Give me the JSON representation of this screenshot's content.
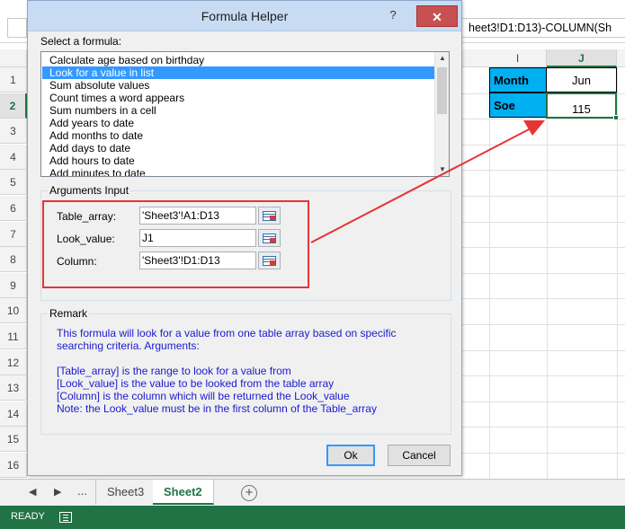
{
  "excel": {
    "formula_bar": {
      "text": "heet3!D1:D13)-COLUMN(Sh"
    },
    "columns": [
      {
        "label": "I",
        "active": false
      },
      {
        "label": "J",
        "active": true
      }
    ],
    "rows": [
      "1",
      "2",
      "3",
      "4",
      "5",
      "6",
      "7",
      "8",
      "9",
      "10",
      "11",
      "12",
      "13",
      "14",
      "15",
      "16"
    ],
    "active_row": "2",
    "cells": {
      "i1": "Month",
      "j1": "Jun",
      "i2": "Soe",
      "j2": "115"
    },
    "sheet_tabs": {
      "nav_prev": "◀",
      "nav_next": "▶",
      "ellipsis": "...",
      "tabs": [
        "Sheet3",
        "Sheet2"
      ],
      "active": "Sheet2",
      "add": "+"
    },
    "status": {
      "ready": "READY"
    },
    "colors": {
      "brand": "#217346",
      "highlight": "#00b0f0",
      "annotation": "#e53535"
    }
  },
  "dialog": {
    "title": "Formula Helper",
    "help": "?",
    "close": "✕",
    "select_label": "Select a formula:",
    "formulas": [
      "Calculate age based on birthday",
      "Look for a value in list",
      "Sum absolute values",
      "Count times a word appears",
      "Sum numbers in a cell",
      "Add years to date",
      "Add months to date",
      "Add days to date",
      "Add hours to date",
      "Add minutes to date"
    ],
    "selected_index": 1,
    "arguments_title": "Arguments Input",
    "arguments": [
      {
        "label": "Table_array:",
        "value": "'Sheet3'!A1:D13"
      },
      {
        "label": "Look_value:",
        "value": "J1"
      },
      {
        "label": "Column:",
        "value": "'Sheet3'!D1:D13"
      }
    ],
    "remark_title": "Remark",
    "remark_lines": [
      "This formula will look for a value from one table array based on specific",
      "searching criteria. Arguments:",
      "",
      "[Table_array] is the range to look for a value from",
      "[Look_value] is the value to be looked from the table array",
      "[Column] is the column which will be returned the Look_value",
      "Note: the Look_value must be in the first column of the Table_array"
    ],
    "ok": "Ok",
    "cancel": "Cancel"
  }
}
